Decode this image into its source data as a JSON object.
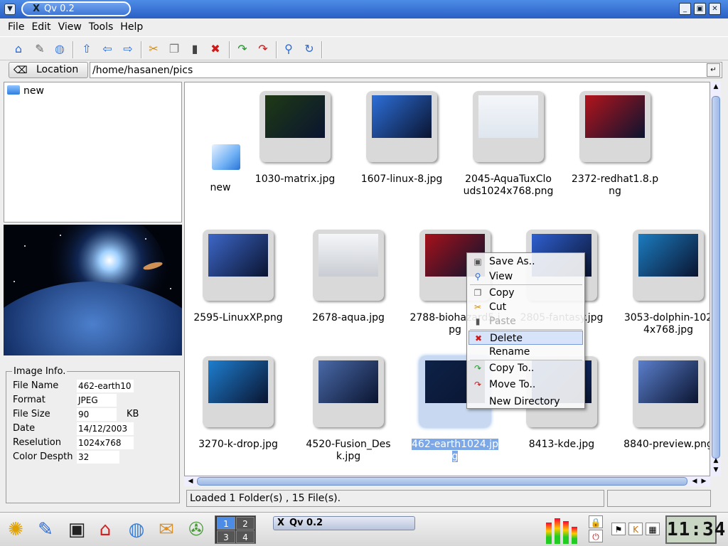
{
  "window": {
    "title": "Qv 0.2"
  },
  "menu": [
    "File",
    "Edit",
    "View",
    "Tools",
    "Help"
  ],
  "location": {
    "label": "Location",
    "path": "/home/hasanen/pics"
  },
  "tree": {
    "items": [
      "new"
    ]
  },
  "info": {
    "title": "Image Info.",
    "rows": [
      {
        "label": "File Name",
        "value": "462-earth10",
        "unit": ""
      },
      {
        "label": "Format",
        "value": "JPEG",
        "unit": ""
      },
      {
        "label": "File Size",
        "value": "90",
        "unit": "KB"
      },
      {
        "label": "Date",
        "value": "14/12/2003",
        "unit": ""
      },
      {
        "label": "Reselution",
        "value": "1024x768",
        "unit": ""
      },
      {
        "label": "Color Despth",
        "value": "32",
        "unit": ""
      }
    ]
  },
  "files": [
    {
      "name": "new"
    },
    {
      "name": "1030-matrix.jpg",
      "color": "#1f3a14"
    },
    {
      "name": "1607-linux-8.jpg",
      "color": "#2d6fd8"
    },
    {
      "name": "2045-AquaTuxClouds1024x768.png",
      "color": "#dfe6ef"
    },
    {
      "name": "2372-redhat1.8.png",
      "color": "#b3141c"
    },
    {
      "name": "2595-LinuxXP.png",
      "color": "#3d67c8"
    },
    {
      "name": "2678-aqua.jpg",
      "color": "#c9ccd2"
    },
    {
      "name": "2788-biohazard5.jpg",
      "color": "#a5111a"
    },
    {
      "name": "2805-fantasy.jpg",
      "color": "#2f5fd0"
    },
    {
      "name": "3053-dolphin-1024x768.jpg",
      "color": "#1c7cc0"
    },
    {
      "name": "3270-k-drop.jpg",
      "color": "#1e7ecf"
    },
    {
      "name": "4520-Fusion_Desk.jpg",
      "color": "#4a6aa8"
    },
    {
      "name": "462-earth1024.jpg",
      "color": "#0d2248"
    },
    {
      "name": "8413-kde.jpg",
      "color": "#153f9a"
    },
    {
      "name": "8840-preview.png",
      "color": "#5b7fcc"
    }
  ],
  "context_menu": {
    "items": [
      {
        "label": "Save As..",
        "icon": "save-icon"
      },
      {
        "label": "View",
        "icon": "magnifier-icon"
      },
      {
        "label": "Copy",
        "icon": "copy-icon"
      },
      {
        "label": "Cut",
        "icon": "scissors-icon"
      },
      {
        "label": "Paste",
        "icon": "paste-icon",
        "disabled": true
      },
      {
        "label": "Delete",
        "icon": "delete-icon",
        "highlighted": true
      },
      {
        "label": "Rename",
        "icon": ""
      },
      {
        "label": "Copy To..",
        "icon": "copy-to-icon"
      },
      {
        "label": "Move To..",
        "icon": "move-to-icon"
      },
      {
        "label": "New Directory",
        "icon": ""
      }
    ]
  },
  "status": {
    "text": "Loaded 1 Folder(s) , 15 File(s)."
  },
  "taskbar": {
    "pager": [
      "1",
      "2",
      "3",
      "4"
    ],
    "active_desktop": "1",
    "task_title": "Qv 0.2",
    "clock": "11:34"
  },
  "colors": {
    "titlebar": "#3a72d6",
    "selection": "#7ca8e8"
  }
}
